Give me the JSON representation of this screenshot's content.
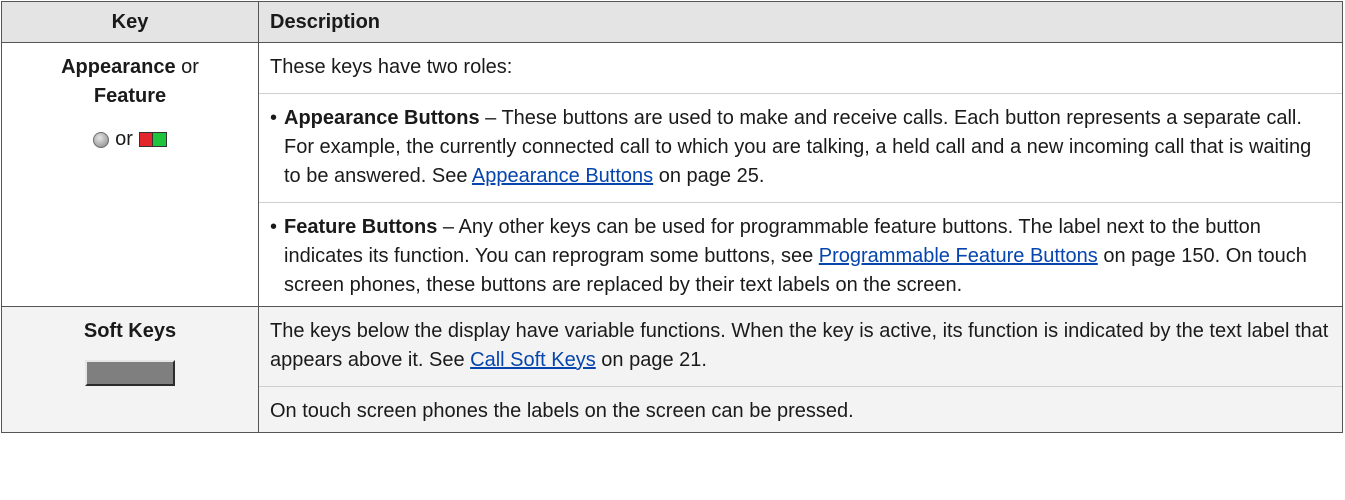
{
  "headers": {
    "key": "Key",
    "description": "Description"
  },
  "row1": {
    "key_name_1": "Appearance",
    "key_or_1": " or",
    "key_name_2": "Feature",
    "icons_or": "or",
    "icons": [
      "grey-round-led-icon",
      "red-green-led-icon"
    ],
    "intro": "These keys have two roles:",
    "bullet1": {
      "bullet": "•",
      "bold": "Appearance Buttons",
      "text1": " – These buttons are used to make and receive calls. Each button represents a separate call. For example, the currently connected call to which you are talking, a held call and a new incoming call that is waiting to be answered. See ",
      "link": "Appearance Buttons",
      "text2": " on page 25."
    },
    "bullet2": {
      "bullet": "•",
      "bold": "Feature Buttons",
      "text1": " – Any other keys can be used for programmable feature buttons. The label next to the button indicates its function. You can reprogram some buttons, see ",
      "link": "Programmable Feature Buttons",
      "text2": " on page 150. On touch screen phones, these buttons are replaced by their text labels on the screen."
    }
  },
  "row2": {
    "key_name": "Soft Keys",
    "icon": "soft-key-button-icon",
    "para1_text1": "The keys below the display have variable functions. When the key is active, its function is indicated by the text label that appears above it. See ",
    "para1_link": "Call Soft Keys",
    "para1_text2": " on page 21.",
    "para2": "On touch screen phones the labels on the screen can be pressed."
  },
  "colors": {
    "header_bg": "#e4e4e4",
    "row_grey_bg": "#f3f3f3",
    "link": "#0645ad",
    "border": "#555555",
    "led_red": "#e3262b",
    "led_green": "#1ec43c"
  }
}
